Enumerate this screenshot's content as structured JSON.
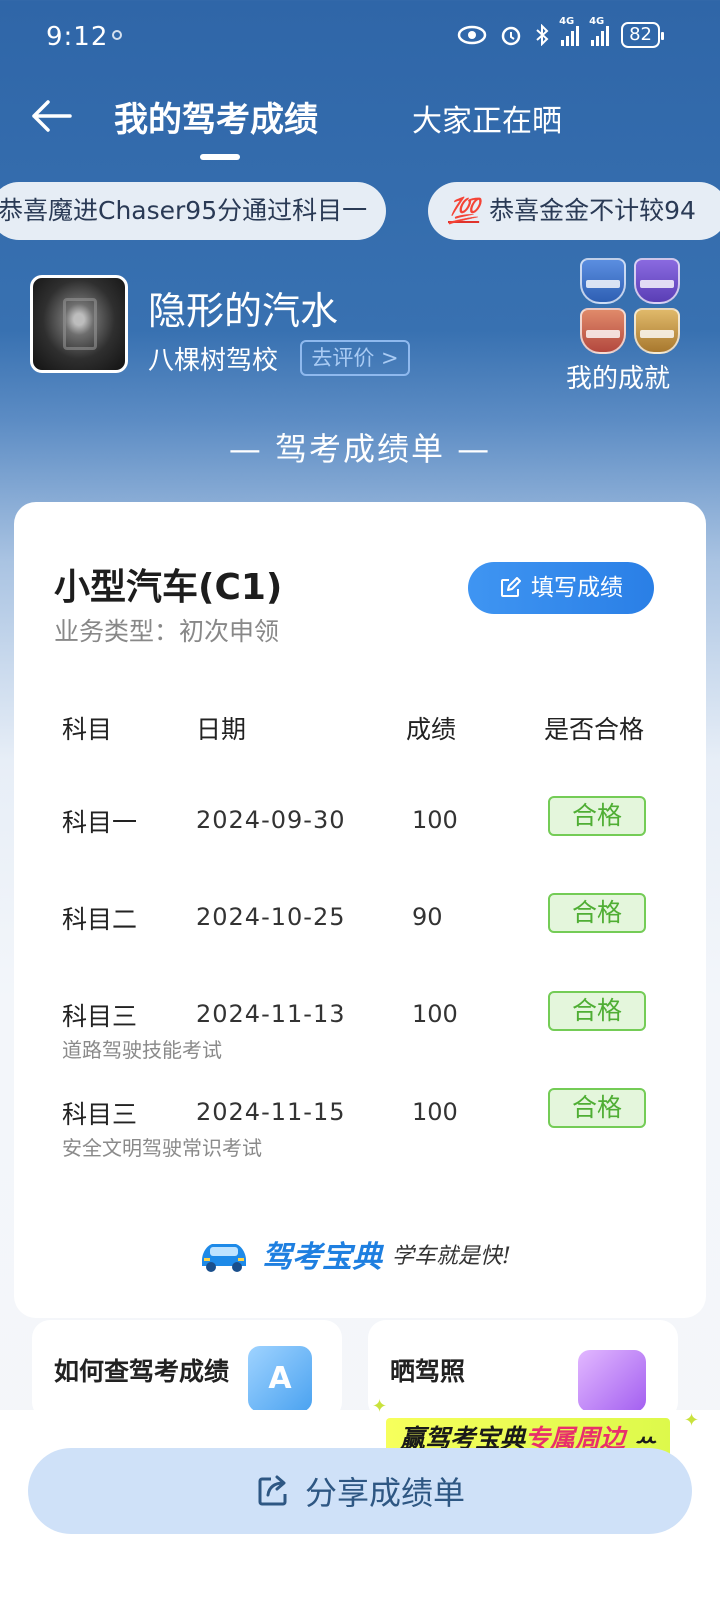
{
  "status_bar": {
    "time": "9:12",
    "battery": "82",
    "network": "4G"
  },
  "header": {
    "tab_active": "我的驾考成绩",
    "tab_other": "大家正在晒"
  },
  "ticker": {
    "item1": "恭喜魔进Chaser95分通过科目一",
    "item2_emoji": "💯",
    "item2": "恭喜金金不计较94"
  },
  "profile": {
    "name": "隐形的汽水",
    "school": "八棵树驾校",
    "rate_label": "去评价 >",
    "achievements_label": "我的成就"
  },
  "section_title": "— 驾考成绩单 —",
  "card": {
    "license_type": "小型汽车(C1)",
    "business_type": "业务类型：初次申领",
    "fill_button": "填写成绩",
    "columns": [
      "科目",
      "日期",
      "成绩",
      "是否合格"
    ],
    "rows": [
      {
        "subject": "科目一",
        "date": "2024-09-30",
        "score": "100",
        "result": "合格",
        "note": ""
      },
      {
        "subject": "科目二",
        "date": "2024-10-25",
        "score": "90",
        "result": "合格",
        "note": ""
      },
      {
        "subject": "科目三",
        "date": "2024-11-13",
        "score": "100",
        "result": "合格",
        "note": "道路驾驶技能考试"
      },
      {
        "subject": "科目三",
        "date": "2024-11-15",
        "score": "100",
        "result": "合格",
        "note": "安全文明驾驶常识考试"
      }
    ],
    "brand_name": "驾考宝典",
    "brand_slogan": "学车就是快!"
  },
  "bottom_cards": [
    {
      "title": "如何查驾考成绩"
    },
    {
      "title": "晒驾照"
    }
  ],
  "promo": {
    "part1": "赢驾考宝典",
    "part2": "专属周边"
  },
  "share_button": "分享成绩单",
  "colors": {
    "primary_blue": "#2f66a8",
    "button_blue": "#2a7fe6",
    "pass_green": "#4fae34",
    "share_bg": "#cfe1f8"
  }
}
